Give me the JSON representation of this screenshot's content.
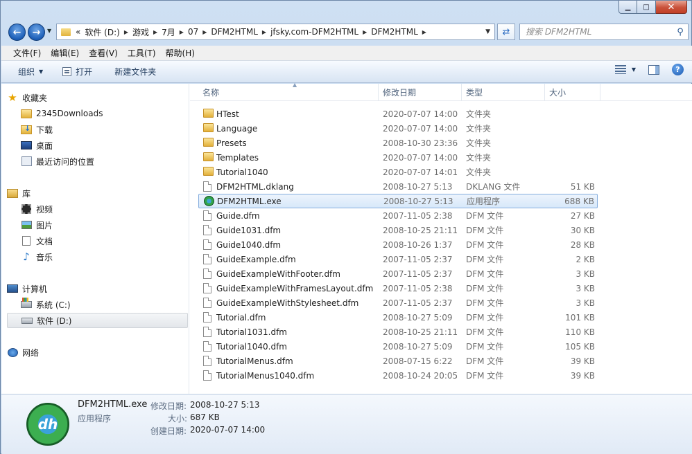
{
  "window": {
    "controls": [
      "minimize",
      "maximize",
      "close"
    ]
  },
  "address": {
    "crumbs": [
      "软件 (D:)",
      "游戏",
      "7月",
      "07",
      "DFM2HTML",
      "jfsky.com-DFM2HTML",
      "DFM2HTML"
    ],
    "overflow": "«"
  },
  "search": {
    "placeholder": "搜索 DFM2HTML"
  },
  "menubar": [
    "文件(F)",
    "编辑(E)",
    "查看(V)",
    "工具(T)",
    "帮助(H)"
  ],
  "toolbar": {
    "organize": "组织",
    "open": "打开",
    "new_folder": "新建文件夹"
  },
  "nav": {
    "favorites": {
      "label": "收藏夹",
      "items": [
        "2345Downloads",
        "下载",
        "桌面",
        "最近访问的位置"
      ]
    },
    "libraries": {
      "label": "库",
      "items": [
        "视频",
        "图片",
        "文档",
        "音乐"
      ]
    },
    "computer": {
      "label": "计算机",
      "items": [
        "系统 (C:)",
        "软件 (D:)"
      ]
    },
    "network": {
      "label": "网络"
    }
  },
  "columns": {
    "name": "名称",
    "date": "修改日期",
    "type": "类型",
    "size": "大小"
  },
  "files": [
    {
      "name": "HTest",
      "date": "2020-07-07 14:00",
      "type": "文件夹",
      "size": "",
      "kind": "folder"
    },
    {
      "name": "Language",
      "date": "2020-07-07 14:00",
      "type": "文件夹",
      "size": "",
      "kind": "folder"
    },
    {
      "name": "Presets",
      "date": "2008-10-30 23:36",
      "type": "文件夹",
      "size": "",
      "kind": "folder"
    },
    {
      "name": "Templates",
      "date": "2020-07-07 14:00",
      "type": "文件夹",
      "size": "",
      "kind": "folder"
    },
    {
      "name": "Tutorial1040",
      "date": "2020-07-07 14:01",
      "type": "文件夹",
      "size": "",
      "kind": "folder"
    },
    {
      "name": "DFM2HTML.dklang",
      "date": "2008-10-27 5:13",
      "type": "DKLANG 文件",
      "size": "51 KB",
      "kind": "file"
    },
    {
      "name": "DFM2HTML.exe",
      "date": "2008-10-27 5:13",
      "type": "应用程序",
      "size": "688 KB",
      "kind": "exe",
      "selected": true
    },
    {
      "name": "Guide.dfm",
      "date": "2007-11-05 2:38",
      "type": "DFM 文件",
      "size": "27 KB",
      "kind": "file"
    },
    {
      "name": "Guide1031.dfm",
      "date": "2008-10-25 21:11",
      "type": "DFM 文件",
      "size": "30 KB",
      "kind": "file"
    },
    {
      "name": "Guide1040.dfm",
      "date": "2008-10-26 1:37",
      "type": "DFM 文件",
      "size": "28 KB",
      "kind": "file"
    },
    {
      "name": "GuideExample.dfm",
      "date": "2007-11-05 2:37",
      "type": "DFM 文件",
      "size": "2 KB",
      "kind": "file"
    },
    {
      "name": "GuideExampleWithFooter.dfm",
      "date": "2007-11-05 2:37",
      "type": "DFM 文件",
      "size": "3 KB",
      "kind": "file"
    },
    {
      "name": "GuideExampleWithFramesLayout.dfm",
      "date": "2007-11-05 2:38",
      "type": "DFM 文件",
      "size": "3 KB",
      "kind": "file"
    },
    {
      "name": "GuideExampleWithStylesheet.dfm",
      "date": "2007-11-05 2:37",
      "type": "DFM 文件",
      "size": "3 KB",
      "kind": "file"
    },
    {
      "name": "Tutorial.dfm",
      "date": "2008-10-27 5:09",
      "type": "DFM 文件",
      "size": "101 KB",
      "kind": "file"
    },
    {
      "name": "Tutorial1031.dfm",
      "date": "2008-10-25 21:11",
      "type": "DFM 文件",
      "size": "110 KB",
      "kind": "file"
    },
    {
      "name": "Tutorial1040.dfm",
      "date": "2008-10-27 5:09",
      "type": "DFM 文件",
      "size": "105 KB",
      "kind": "file"
    },
    {
      "name": "TutorialMenus.dfm",
      "date": "2008-07-15 6:22",
      "type": "DFM 文件",
      "size": "39 KB",
      "kind": "file"
    },
    {
      "name": "TutorialMenus1040.dfm",
      "date": "2008-10-24 20:05",
      "type": "DFM 文件",
      "size": "39 KB",
      "kind": "file"
    }
  ],
  "details": {
    "filename": "DFM2HTML.exe",
    "filetype": "应用程序",
    "modified_label": "修改日期:",
    "modified_value": "2008-10-27 5:13",
    "size_label": "大小:",
    "size_value": "687 KB",
    "created_label": "创建日期:",
    "created_value": "2020-07-07 14:00",
    "icon_text": "dh"
  }
}
